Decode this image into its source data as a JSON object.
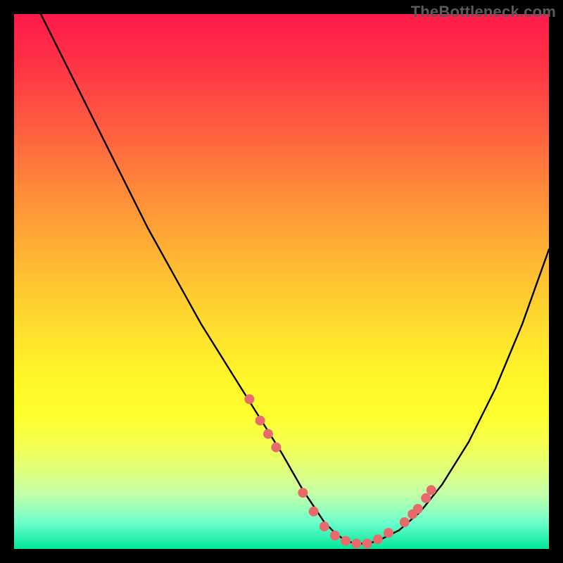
{
  "watermark": "TheBottleneck.com",
  "chart_data": {
    "type": "line",
    "title": "",
    "xlabel": "",
    "ylabel": "",
    "xlim": [
      0,
      100
    ],
    "ylim": [
      0,
      100
    ],
    "grid": false,
    "legend": false,
    "series": [
      {
        "name": "bottleneck-curve",
        "x": [
          5,
          10,
          15,
          20,
          25,
          30,
          35,
          40,
          45,
          50,
          54,
          56,
          58,
          60,
          62,
          64,
          66,
          68,
          72,
          76,
          80,
          85,
          90,
          95,
          100
        ],
        "y": [
          100,
          90,
          80,
          70,
          60,
          51,
          42,
          34,
          26,
          18,
          11,
          8,
          5,
          3,
          1.5,
          1,
          1,
          1.5,
          3.5,
          7,
          12,
          20,
          30,
          42,
          56
        ],
        "style": "black-line"
      }
    ],
    "markers": [
      {
        "x": 44,
        "y": 28
      },
      {
        "x": 46,
        "y": 24
      },
      {
        "x": 47.5,
        "y": 21.5
      },
      {
        "x": 49,
        "y": 19
      },
      {
        "x": 54,
        "y": 10.5
      },
      {
        "x": 56,
        "y": 7
      },
      {
        "x": 58,
        "y": 4.2
      },
      {
        "x": 60,
        "y": 2.5
      },
      {
        "x": 62,
        "y": 1.5
      },
      {
        "x": 64,
        "y": 1
      },
      {
        "x": 66,
        "y": 1
      },
      {
        "x": 68,
        "y": 1.8
      },
      {
        "x": 70,
        "y": 3
      },
      {
        "x": 73,
        "y": 5
      },
      {
        "x": 74.5,
        "y": 6.5
      },
      {
        "x": 75.5,
        "y": 7.5
      },
      {
        "x": 77,
        "y": 9.5
      },
      {
        "x": 78,
        "y": 11
      }
    ],
    "marker_style": {
      "color": "#e86a6a",
      "radius_px": 7
    },
    "notes": "Chart has no visible axes, ticks, or labels; values inferred from normalized 0-100 plot area. Background is a vertical heatmap gradient (red top to green bottom). Curve is black; a cluster of salmon-pink dots lies along the curve near the minimum (roughly x≈44–78)."
  }
}
